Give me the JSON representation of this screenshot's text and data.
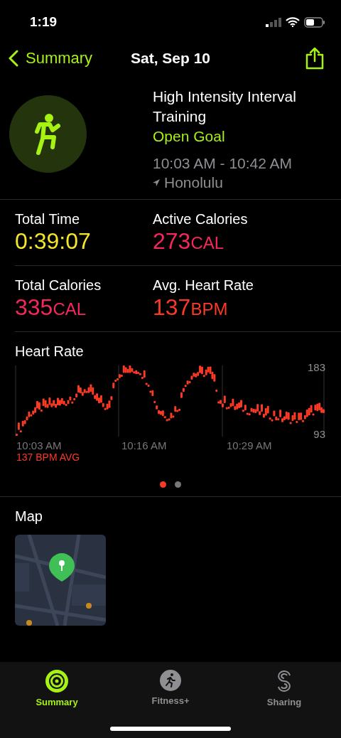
{
  "status_bar": {
    "time": "1:19"
  },
  "nav": {
    "back": "Summary",
    "title": "Sat, Sep 10"
  },
  "workout": {
    "name": "High Intensity Interval Training",
    "goal": "Open Goal",
    "time_range": "10:03 AM - 10:42 AM",
    "location": "Honolulu"
  },
  "stats": [
    {
      "label": "Total Time",
      "value": "0:39:07",
      "color": "#f5e52a"
    },
    {
      "label": "Active Calories",
      "value": "273",
      "unit": "CAL",
      "color": "#f8275b"
    },
    {
      "label": "Total Calories",
      "value": "335",
      "unit": "CAL",
      "color": "#f8275b"
    },
    {
      "label": "Avg. Heart Rate",
      "value": "137",
      "unit": "BPM",
      "color": "#fb3a25"
    }
  ],
  "heart_rate": {
    "title": "Heart Rate",
    "max": "183",
    "min": "93",
    "times": [
      "10:03 AM",
      "10:16 AM",
      "10:29 AM"
    ],
    "average": "137 BPM AVG"
  },
  "pages": [
    {
      "selected": true
    },
    {
      "selected": false
    }
  ],
  "map": {
    "title": "Map",
    "kind": "picture"
  },
  "tabs": [
    {
      "label": "Summary",
      "kind": "rings",
      "selected": true
    },
    {
      "label": "Fitness+",
      "kind": "runner",
      "selected": false
    },
    {
      "label": "Sharing",
      "kind": "sharing",
      "selected": false
    }
  ]
}
